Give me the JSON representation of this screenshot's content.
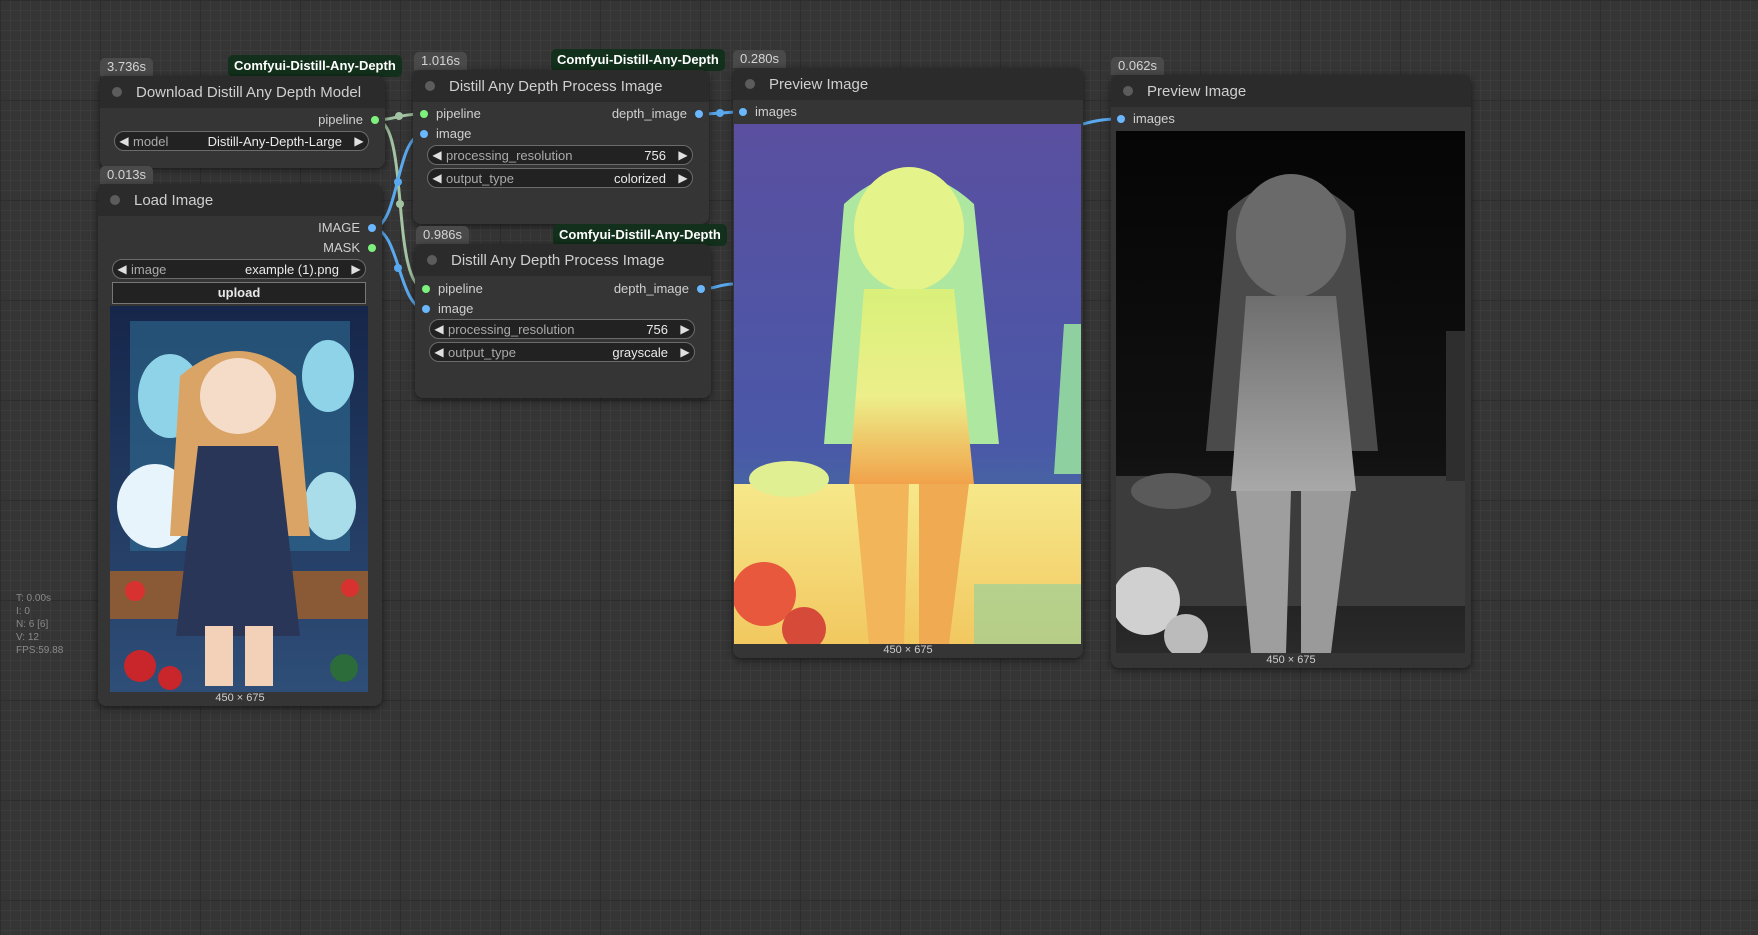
{
  "colors": {
    "canvas_bg": "#353535",
    "node_bg": "#353535",
    "header_bg": "#2b2b2b",
    "pipeline_slot": "#7cf27c",
    "image_slot": "#6ab7ff",
    "pack_badge_bg": "#12301b"
  },
  "nodes": {
    "download_model": {
      "time": "3.736s",
      "badge": "Comfyui-Distill-Any-Depth",
      "title": "Download Distill Any Depth Model",
      "outputs": {
        "pipeline": "pipeline"
      },
      "widgets": {
        "model_label": "model",
        "model_value": "Distill-Any-Depth-Large"
      }
    },
    "load_image": {
      "time": "0.013s",
      "title": "Load Image",
      "outputs": {
        "image": "IMAGE",
        "mask": "MASK"
      },
      "widgets": {
        "image_label": "image",
        "image_value": "example (1).png",
        "upload_label": "upload"
      },
      "dims": "450 × 675"
    },
    "process_1": {
      "time": "1.016s",
      "badge": "Comfyui-Distill-Any-Depth",
      "title": "Distill Any Depth Process Image",
      "inputs": {
        "pipeline": "pipeline",
        "image": "image"
      },
      "outputs": {
        "depth_image": "depth_image"
      },
      "widgets": {
        "res_label": "processing_resolution",
        "res_value": "756",
        "type_label": "output_type",
        "type_value": "colorized"
      }
    },
    "process_2": {
      "time": "0.986s",
      "badge": "Comfyui-Distill-Any-Depth",
      "title": "Distill Any Depth Process Image",
      "inputs": {
        "pipeline": "pipeline",
        "image": "image"
      },
      "outputs": {
        "depth_image": "depth_image"
      },
      "widgets": {
        "res_label": "processing_resolution",
        "res_value": "756",
        "type_label": "output_type",
        "type_value": "grayscale"
      }
    },
    "preview_1": {
      "time": "0.280s",
      "title": "Preview Image",
      "inputs": {
        "images": "images"
      },
      "dims": "450 × 675"
    },
    "preview_2": {
      "time": "0.062s",
      "title": "Preview Image",
      "inputs": {
        "images": "images"
      },
      "dims": "450 × 675"
    }
  },
  "stats": {
    "t": "T: 0.00s",
    "i": "I: 0",
    "n": "N: 6 [6]",
    "v": "V: 12",
    "fps": "FPS:59.88"
  }
}
